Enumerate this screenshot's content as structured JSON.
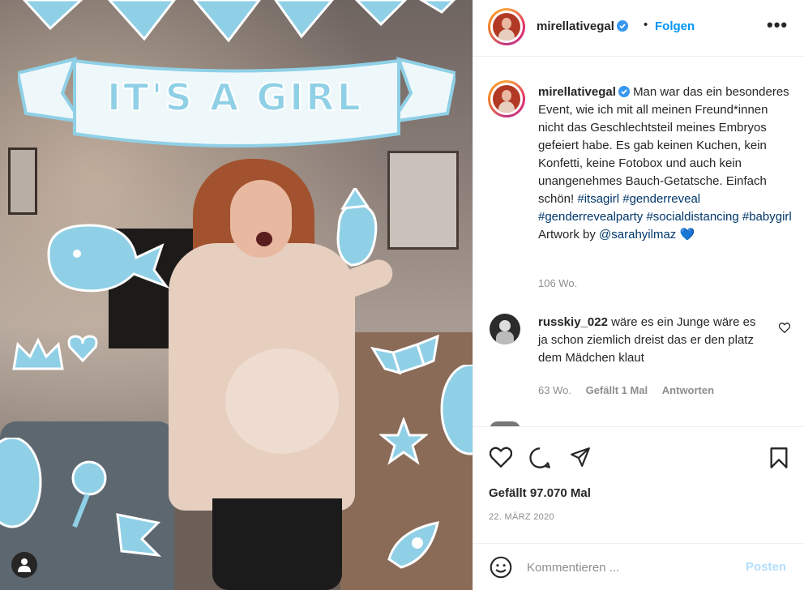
{
  "post": {
    "username": "mirellativegal",
    "header_separator": "•",
    "follow_label": "Folgen",
    "more_icon": "•••",
    "image_banner_text": "IT'S A GIRL"
  },
  "caption": {
    "username": "mirellativegal",
    "text": "Man war das ein besonderes Event, wie ich mit all meinen Freund*innen nicht das Geschlechtsteil meines Embryos gefeiert habe. Es gab keinen Kuchen, kein Konfetti, keine Fotobox und auch kein unangenehmes Bauch-Getatsche. Einfach schön!",
    "hashtags": [
      "#itsagirl",
      "#genderreveal",
      "#genderrevealparty",
      "#socialdistancing",
      "#babygirl"
    ],
    "artwork_label": "Artwork by",
    "artist_mention": "@sarahyilmaz",
    "emoji": "💙",
    "time": "106 Wo."
  },
  "comment": {
    "username": "russkiy_022",
    "text": "wäre es ein Junge wäre es ja schon ziemlich dreist das er den platz dem Mädchen klaut",
    "time": "63 Wo.",
    "likes_label": "Gefällt 1 Mal",
    "reply_label": "Antworten"
  },
  "stats": {
    "likes_text": "Gefällt 97.070 Mal",
    "date": "22. MÄRZ 2020"
  },
  "composer": {
    "placeholder": "Kommentieren ...",
    "post_label": "Posten"
  },
  "icons": {
    "verified": "verified-badge-icon",
    "like": "heart-icon",
    "comment": "comment-bubble-icon",
    "share": "paper-plane-icon",
    "save": "bookmark-icon",
    "emoji": "smiley-icon",
    "tagged_user": "user-tag-icon"
  },
  "colors": {
    "link_blue": "#0095f6",
    "hashtag": "#00376b",
    "verified_blue": "#3897f0",
    "doodle_blue": "#8fd0e6",
    "post_disabled": "#b2dffc"
  }
}
